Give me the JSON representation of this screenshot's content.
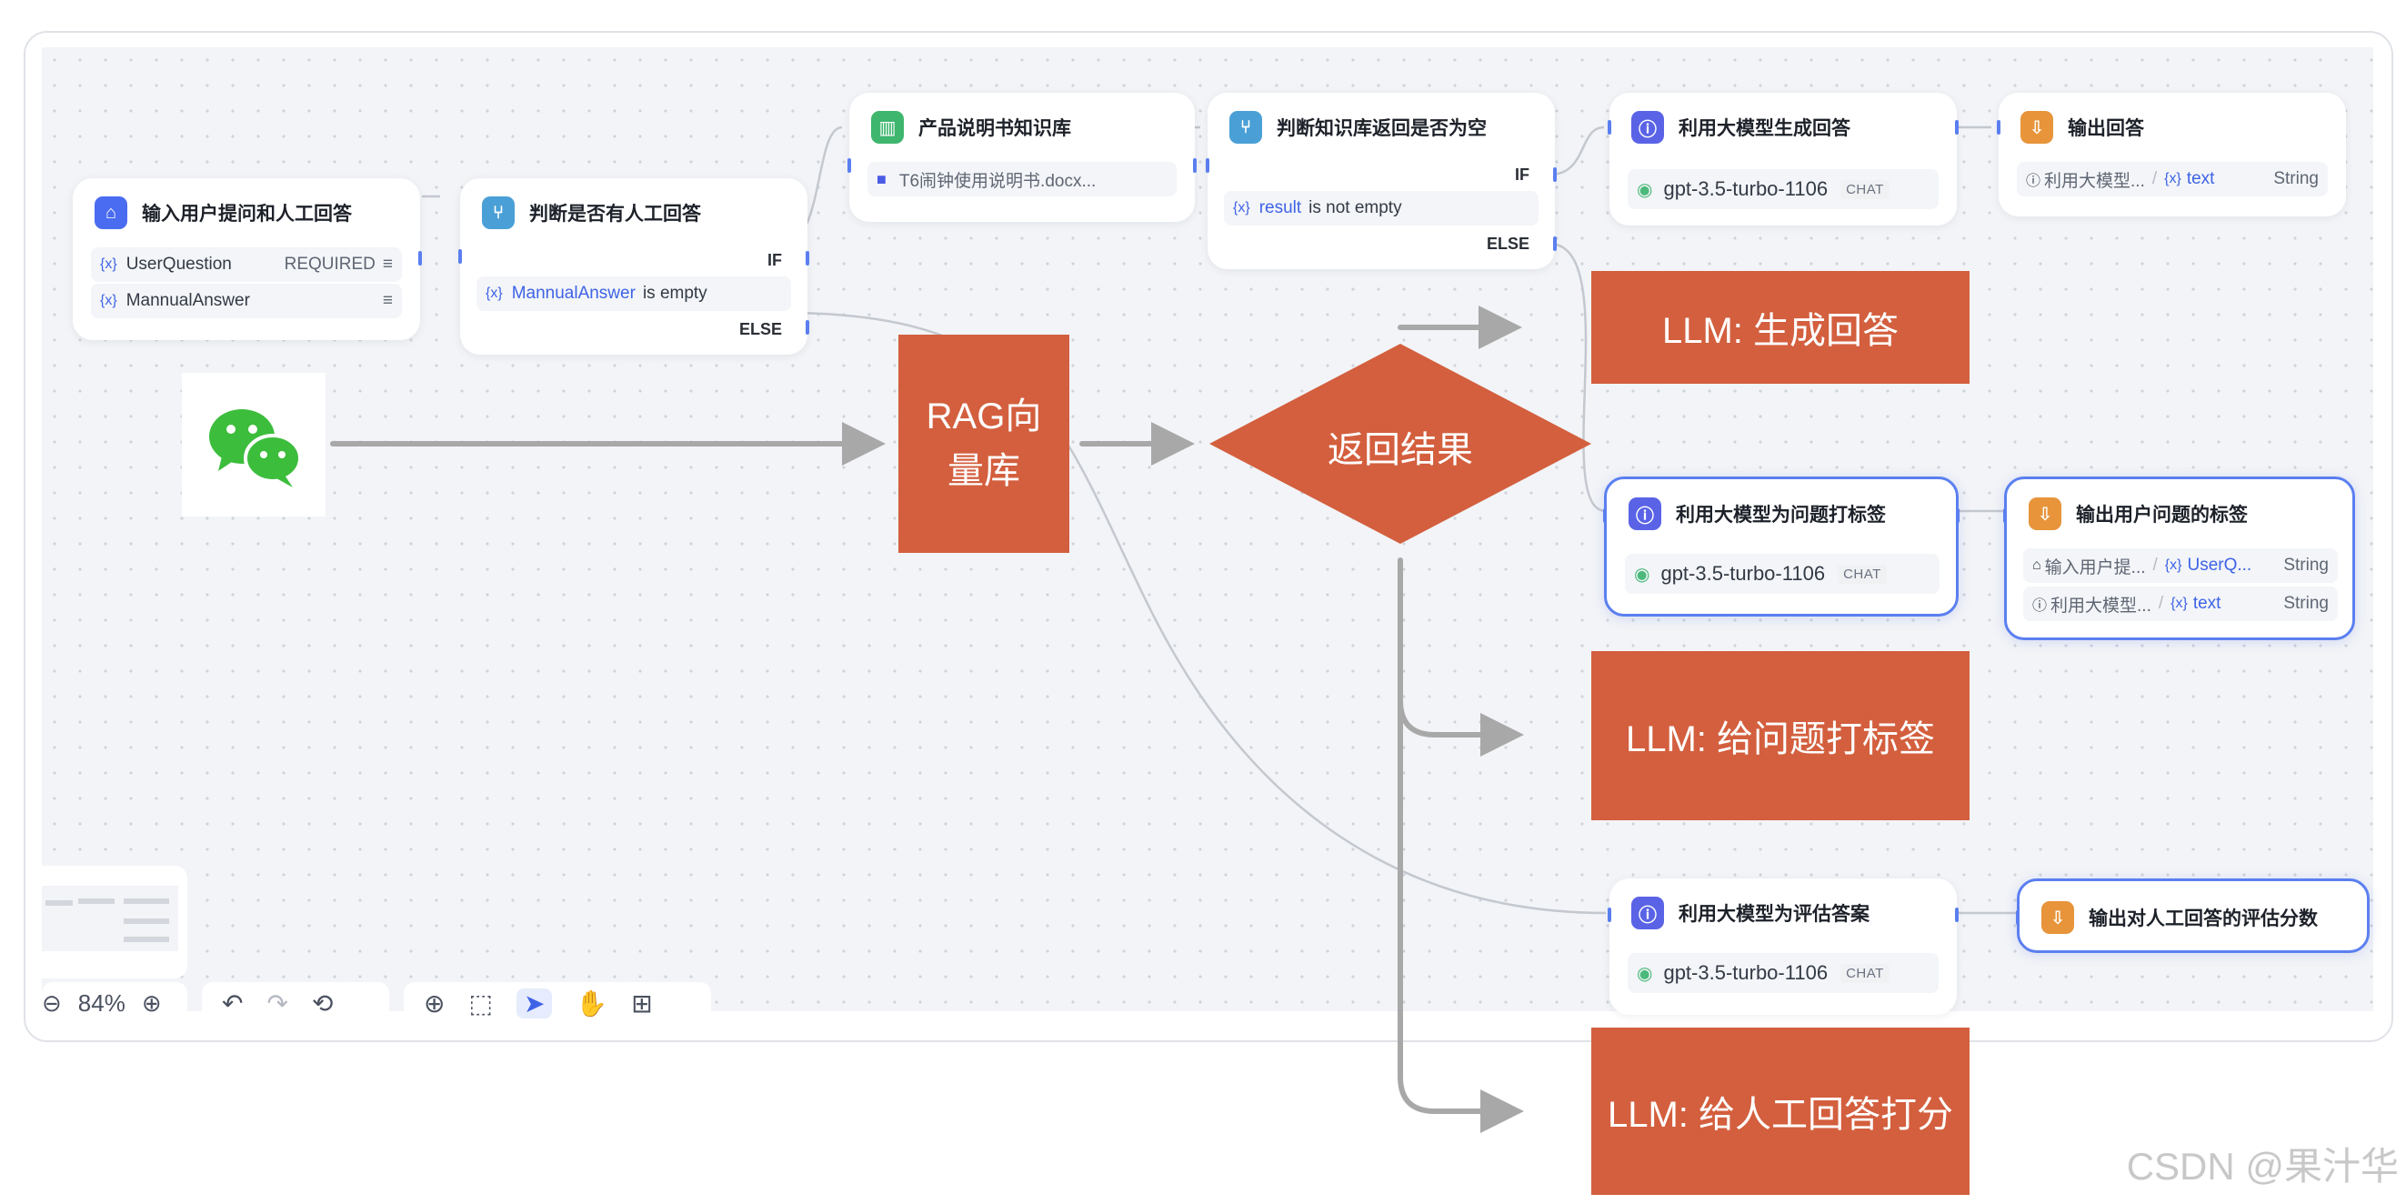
{
  "nodes": {
    "start": {
      "title": "输入用户提问和人工回答",
      "var1": "UserQuestion",
      "required": "REQUIRED",
      "var2": "MannualAnswer"
    },
    "cond1": {
      "title": "判断是否有人工回答",
      "if": "IF",
      "cond_var": "MannualAnswer",
      "cond_op": "is empty",
      "else": "ELSE"
    },
    "kb": {
      "title": "产品说明书知识库",
      "file": "T6闹钟使用说明书.docx..."
    },
    "cond2": {
      "title": "判断知识库返回是否为空",
      "if": "IF",
      "cond_var": "result",
      "cond_op": "is not empty",
      "else": "ELSE"
    },
    "llm1": {
      "title": "利用大模型生成回答",
      "model": "gpt-3.5-turbo-1106",
      "tag": "CHAT"
    },
    "out1": {
      "title": "输出回答",
      "src": "利用大模型...",
      "var": "text",
      "type": "String"
    },
    "llm2": {
      "title": "利用大模型为问题打标签",
      "model": "gpt-3.5-turbo-1106",
      "tag": "CHAT"
    },
    "out2": {
      "title": "输出用户问题的标签",
      "src1": "输入用户提...",
      "var1": "UserQ...",
      "type1": "String",
      "src2": "利用大模型...",
      "var2": "text",
      "type2": "String"
    },
    "llm3": {
      "title": "利用大模型为评估答案",
      "model": "gpt-3.5-turbo-1106",
      "tag": "CHAT"
    },
    "out3": {
      "title": "输出对人工回答的评估分数"
    }
  },
  "var_prefix": "{x}",
  "toolbar": {
    "zoom": "84%"
  },
  "overlay": {
    "rag": "RAG向\n量库",
    "decision": "返回结果",
    "llm_generate": "LLM: 生成回答",
    "llm_tag": "LLM: 给问题打标签",
    "llm_score": "LLM: 给人工回答打分"
  },
  "watermark": "CSDN @果汁华",
  "colors": {
    "overlay_orange": "#d35f3e",
    "accent_blue": "#5b7ff0",
    "arrow_gray": "#a8a8a8"
  }
}
